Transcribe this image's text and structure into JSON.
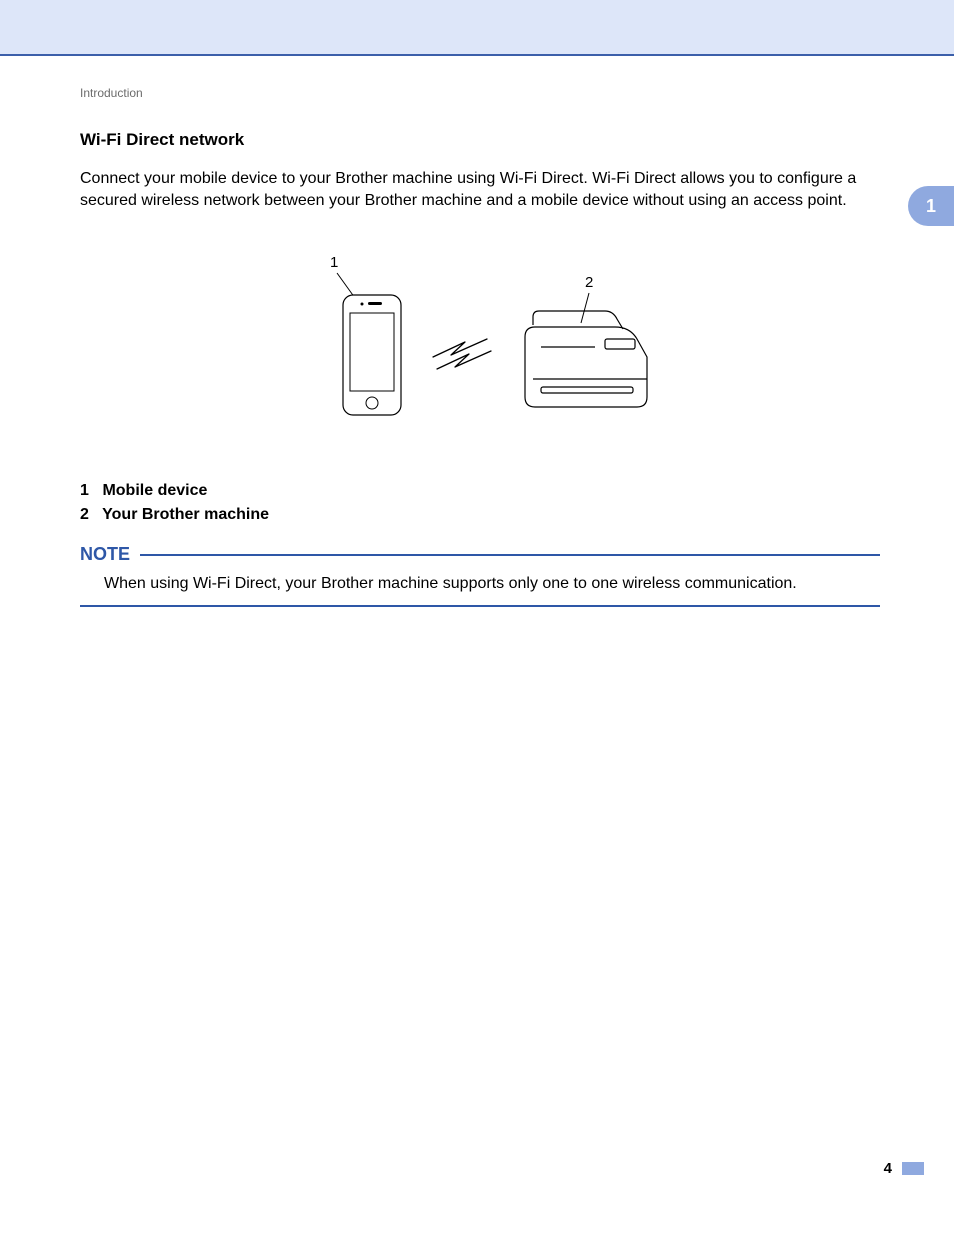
{
  "breadcrumb": "Introduction",
  "section_title": "Wi-Fi Direct network",
  "intro_paragraph": "Connect your mobile device to your Brother machine using Wi-Fi Direct. Wi-Fi Direct allows you to configure a secured wireless network between your Brother machine and a mobile device without using an access point.",
  "figure": {
    "label_mobile": "1",
    "label_printer": "2"
  },
  "legend": {
    "items": [
      {
        "num": "1",
        "text": "Mobile device"
      },
      {
        "num": "2",
        "text": "Your Brother machine"
      }
    ]
  },
  "note": {
    "heading": "NOTE",
    "body": "When using Wi-Fi Direct, your Brother machine supports only one to one wireless communication."
  },
  "chapter_number": "1",
  "page_number": "4"
}
